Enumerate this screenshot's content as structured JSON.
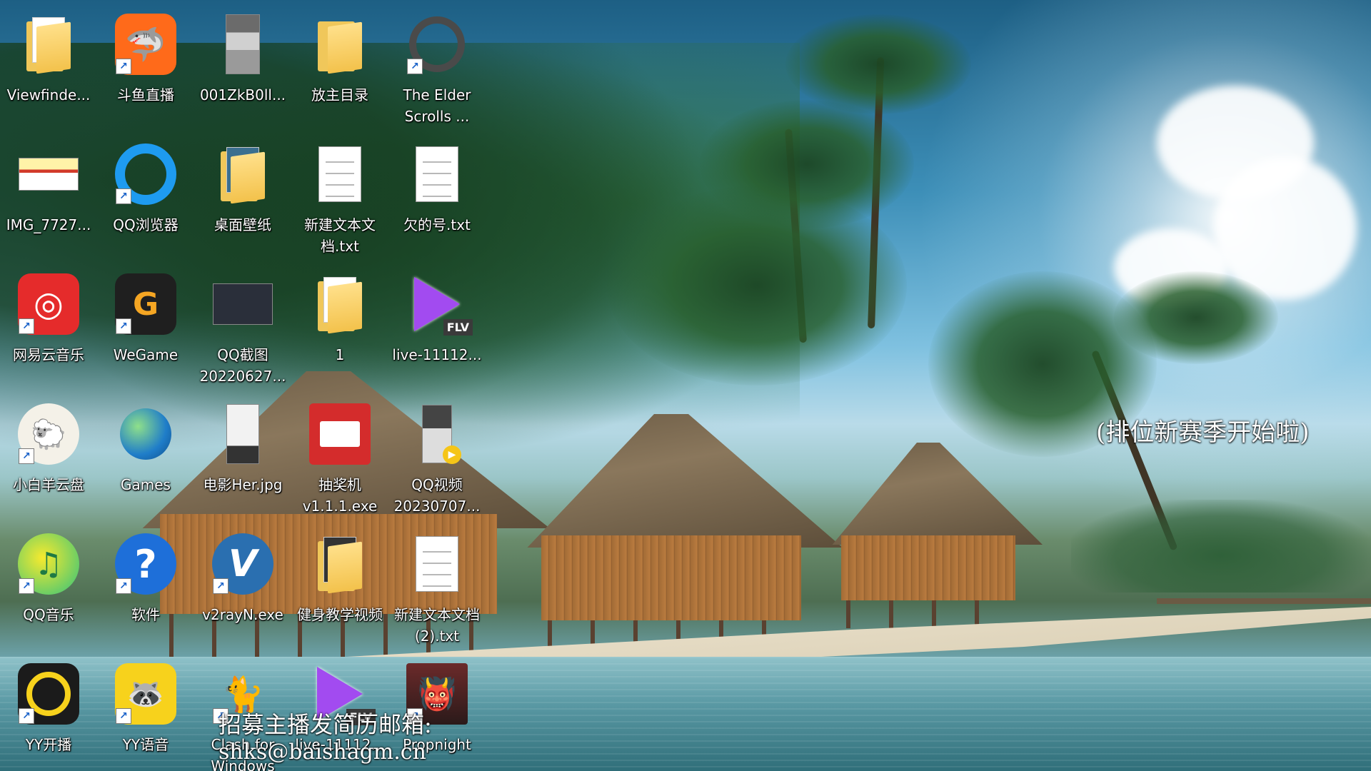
{
  "desktop": {
    "icons": [
      {
        "label": "Viewfinde...",
        "icon": "folder-icon"
      },
      {
        "label": "斗鱼直播",
        "icon": "douyu-icon"
      },
      {
        "label": "001ZkB0ll...",
        "icon": "image-file-icon"
      },
      {
        "label": "放主目录",
        "icon": "folder-icon"
      },
      {
        "label": "The Elder\nScrolls ...",
        "icon": "elder-scrolls-icon"
      },
      {
        "label": "IMG_7727...",
        "icon": "image-file-icon"
      },
      {
        "label": "QQ浏览器",
        "icon": "qq-browser-icon"
      },
      {
        "label": "桌面壁纸",
        "icon": "folder-icon"
      },
      {
        "label": "新建文本文\n档.txt",
        "icon": "text-file-icon"
      },
      {
        "label": "欠的号.txt",
        "icon": "text-file-icon"
      },
      {
        "label": "网易云音乐",
        "icon": "netease-music-icon"
      },
      {
        "label": "WeGame",
        "icon": "wegame-icon"
      },
      {
        "label": "QQ截图\n20220627...",
        "icon": "image-file-icon"
      },
      {
        "label": "1",
        "icon": "folder-icon"
      },
      {
        "label": "live-11112...",
        "icon": "flv-video-icon"
      },
      {
        "label": "小白羊云盘",
        "icon": "sheep-cloud-icon"
      },
      {
        "label": "Games",
        "icon": "games-globe-icon"
      },
      {
        "label": "电影Her.jpg",
        "icon": "image-file-icon"
      },
      {
        "label": "抽奖机\nv1.1.1.exe",
        "icon": "lottery-app-icon"
      },
      {
        "label": "QQ视频\n20230707...",
        "icon": "video-file-icon"
      },
      {
        "label": "QQ音乐",
        "icon": "qq-music-icon"
      },
      {
        "label": "软件",
        "icon": "help-question-icon"
      },
      {
        "label": "v2rayN.exe",
        "icon": "v2rayn-icon"
      },
      {
        "label": "健身教学视频",
        "icon": "folder-icon"
      },
      {
        "label": "新建文本文档\n(2).txt",
        "icon": "text-file-icon"
      },
      {
        "label": "YY开播",
        "icon": "yy-live-icon"
      },
      {
        "label": "YY语音",
        "icon": "yy-voice-icon"
      },
      {
        "label": "Clash for\nWindows",
        "icon": "clash-cat-icon"
      },
      {
        "label": "live-11112...",
        "icon": "flv-video-icon"
      },
      {
        "label": "Propnight",
        "icon": "propnight-icon"
      }
    ],
    "flv_tag": "FLV",
    "overlay_right": "(排位新赛季开始啦)",
    "overlay_bottom_line1": "招募主播发简历邮箱:",
    "overlay_bottom_line2": "shks@baishagm.cn"
  }
}
